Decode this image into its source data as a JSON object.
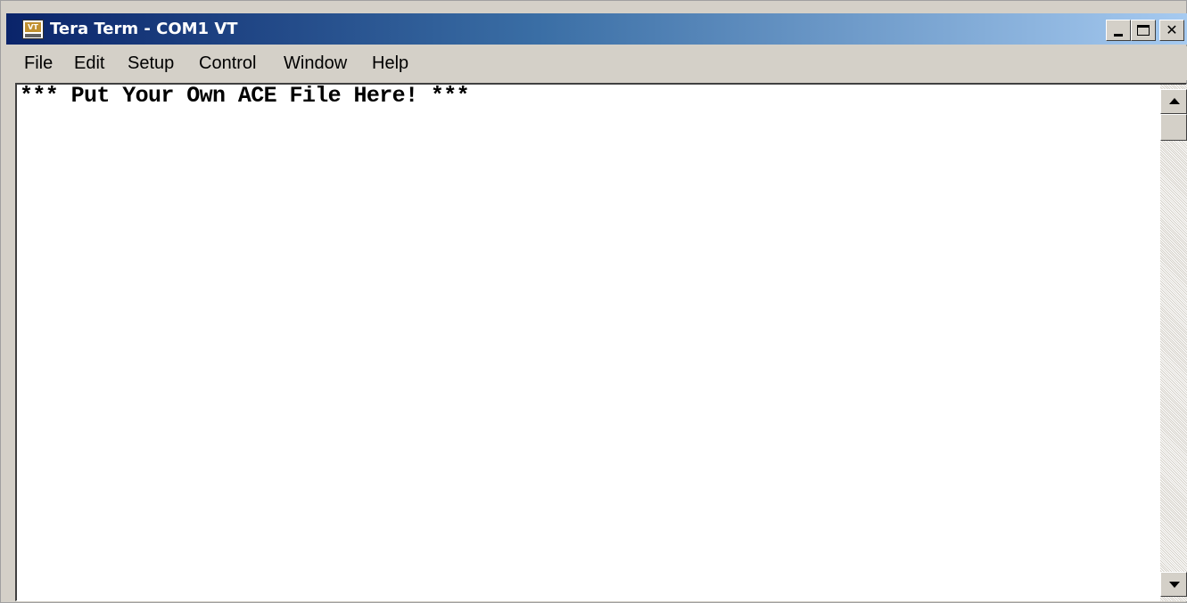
{
  "window": {
    "title": "Tera Term - COM1 VT",
    "icon": "vt-terminal-icon",
    "icon_label": "VT",
    "controls": {
      "minimize": "minimize-icon",
      "maximize": "maximize-icon",
      "close": "close-icon",
      "close_glyph": "✕"
    },
    "colors": {
      "titlebar_start": "#0a246a",
      "titlebar_end": "#a6caf0",
      "chrome": "#d4d0c8",
      "terminal_bg": "#ffffff",
      "terminal_text": "#000000"
    }
  },
  "menu": {
    "items": [
      {
        "label": "File"
      },
      {
        "label": "Edit"
      },
      {
        "label": "Setup"
      },
      {
        "label": "Control"
      },
      {
        "label": "Window"
      },
      {
        "label": "Help"
      }
    ]
  },
  "terminal": {
    "lines": [
      "*** Put Your Own ACE File Here! ***"
    ]
  },
  "scrollbar": {
    "up_icon": "scroll-up-arrow-icon",
    "down_icon": "scroll-down-arrow-icon"
  }
}
